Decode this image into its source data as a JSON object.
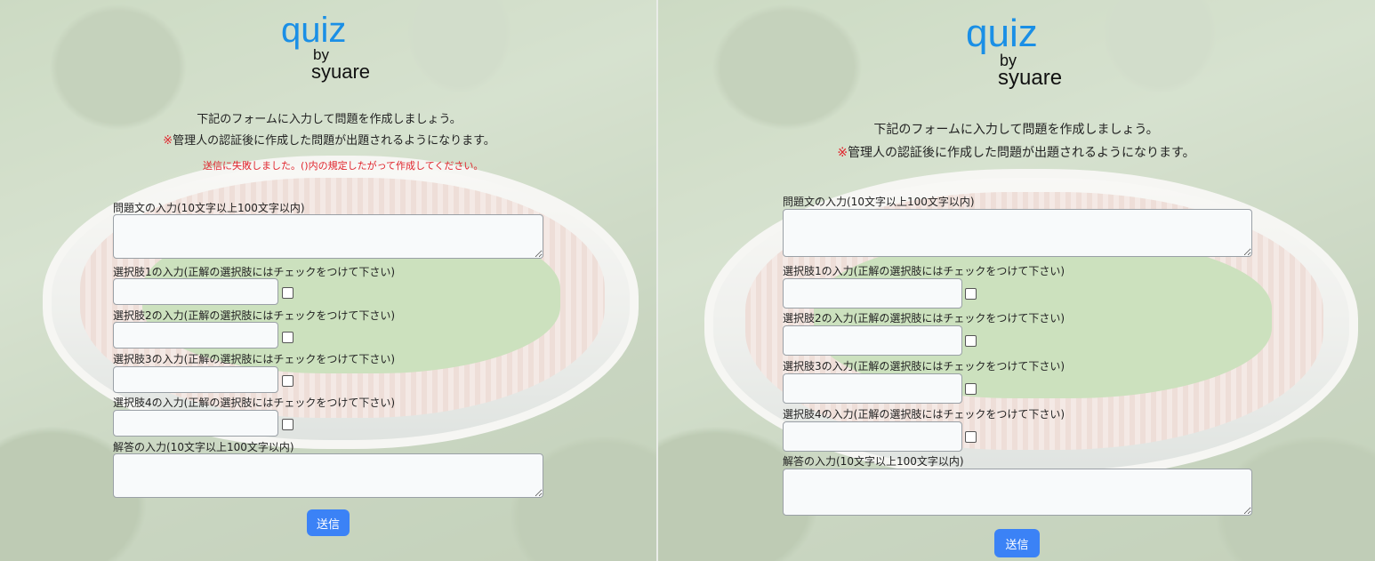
{
  "panels": [
    {
      "logo": {
        "title": "quiz",
        "by": "by",
        "author": "syuare"
      },
      "intro": {
        "line1": "下記のフォームに入力して問題を作成しましょう。",
        "mark": "※",
        "line2": "管理人の認証後に作成した問題が出題されるようになります。"
      },
      "error": "送信に失敗しました。()内の規定したがって作成してください。",
      "form": {
        "question_label": "問題文の入力(10文字以上100文字以内)",
        "choice1_label": "選択肢1の入力(正解の選択肢にはチェックをつけて下さい)",
        "choice2_label": "選択肢2の入力(正解の選択肢にはチェックをつけて下さい)",
        "choice3_label": "選択肢3の入力(正解の選択肢にはチェックをつけて下さい)",
        "choice4_label": "選択肢4の入力(正解の選択肢にはチェックをつけて下さい)",
        "answer_label": "解答の入力(10文字以上100文字以内)",
        "submit_label": "送信"
      }
    },
    {
      "logo": {
        "title": "quiz",
        "by": "by",
        "author": "syuare"
      },
      "intro": {
        "line1": "下記のフォームに入力して問題を作成しましょう。",
        "mark": "※",
        "line2": "管理人の認証後に作成した問題が出題されるようになります。"
      },
      "form": {
        "question_label": "問題文の入力(10文字以上100文字以内)",
        "choice1_label": "選択肢1の入力(正解の選択肢にはチェックをつけて下さい)",
        "choice2_label": "選択肢2の入力(正解の選択肢にはチェックをつけて下さい)",
        "choice3_label": "選択肢3の入力(正解の選択肢にはチェックをつけて下さい)",
        "choice4_label": "選択肢4の入力(正解の選択肢にはチェックをつけて下さい)",
        "answer_label": "解答の入力(10文字以上100文字以内)",
        "submit_label": "送信"
      }
    }
  ],
  "colors": {
    "accent": "#1a8fe6",
    "error": "#e0242c",
    "button": "#3b82f6"
  }
}
